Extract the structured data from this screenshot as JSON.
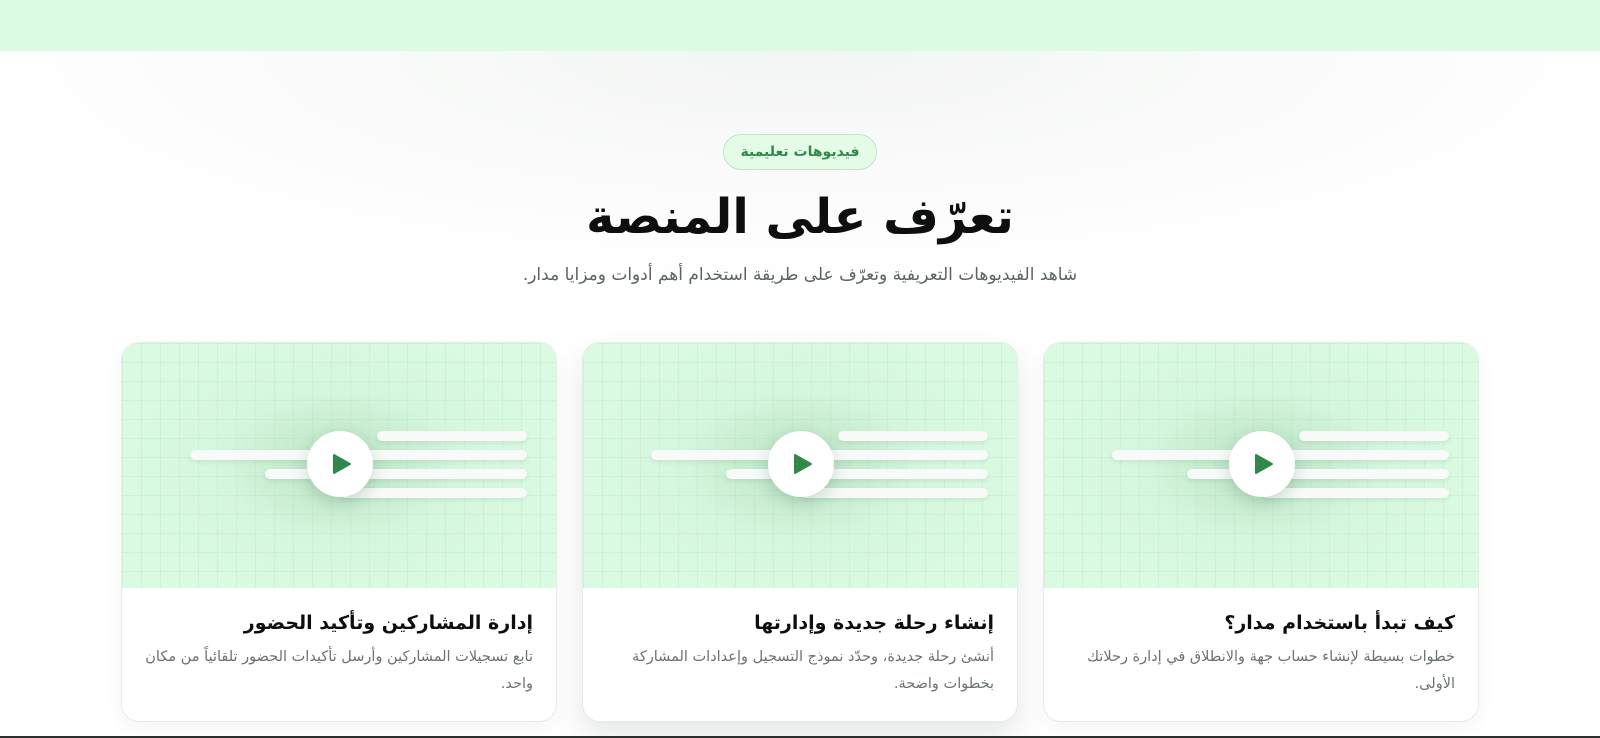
{
  "section": {
    "badge": "فيديوهات تعليمية",
    "title": "تعرّف على المنصة",
    "subtitle": "شاهد الفيديوهات التعريفية وتعرّف على طريقة استخدام أهم أدوات ومزايا مدار."
  },
  "colors": {
    "accent": "#2f8a4a",
    "accent_light": "#dcfbe3",
    "play_icon": "#2f8a4a"
  },
  "cards": [
    {
      "title": "كيف تبدأ باستخدام مدار؟",
      "description": "خطوات بسيطة لإنشاء حساب جهة والانطلاق في إدارة رحلاتك الأولى.",
      "icon": "play-icon"
    },
    {
      "title": "إنشاء رحلة جديدة وإدارتها",
      "description": "أنشئ رحلة جديدة، وحدّد نموذج التسجيل وإعدادات المشاركة بخطوات واضحة.",
      "icon": "play-icon"
    },
    {
      "title": "إدارة المشاركين وتأكيد الحضور",
      "description": "تابع تسجيلات المشاركين وأرسل تأكيدات الحضور تلقائياً من مكان واحد.",
      "icon": "play-icon"
    }
  ]
}
